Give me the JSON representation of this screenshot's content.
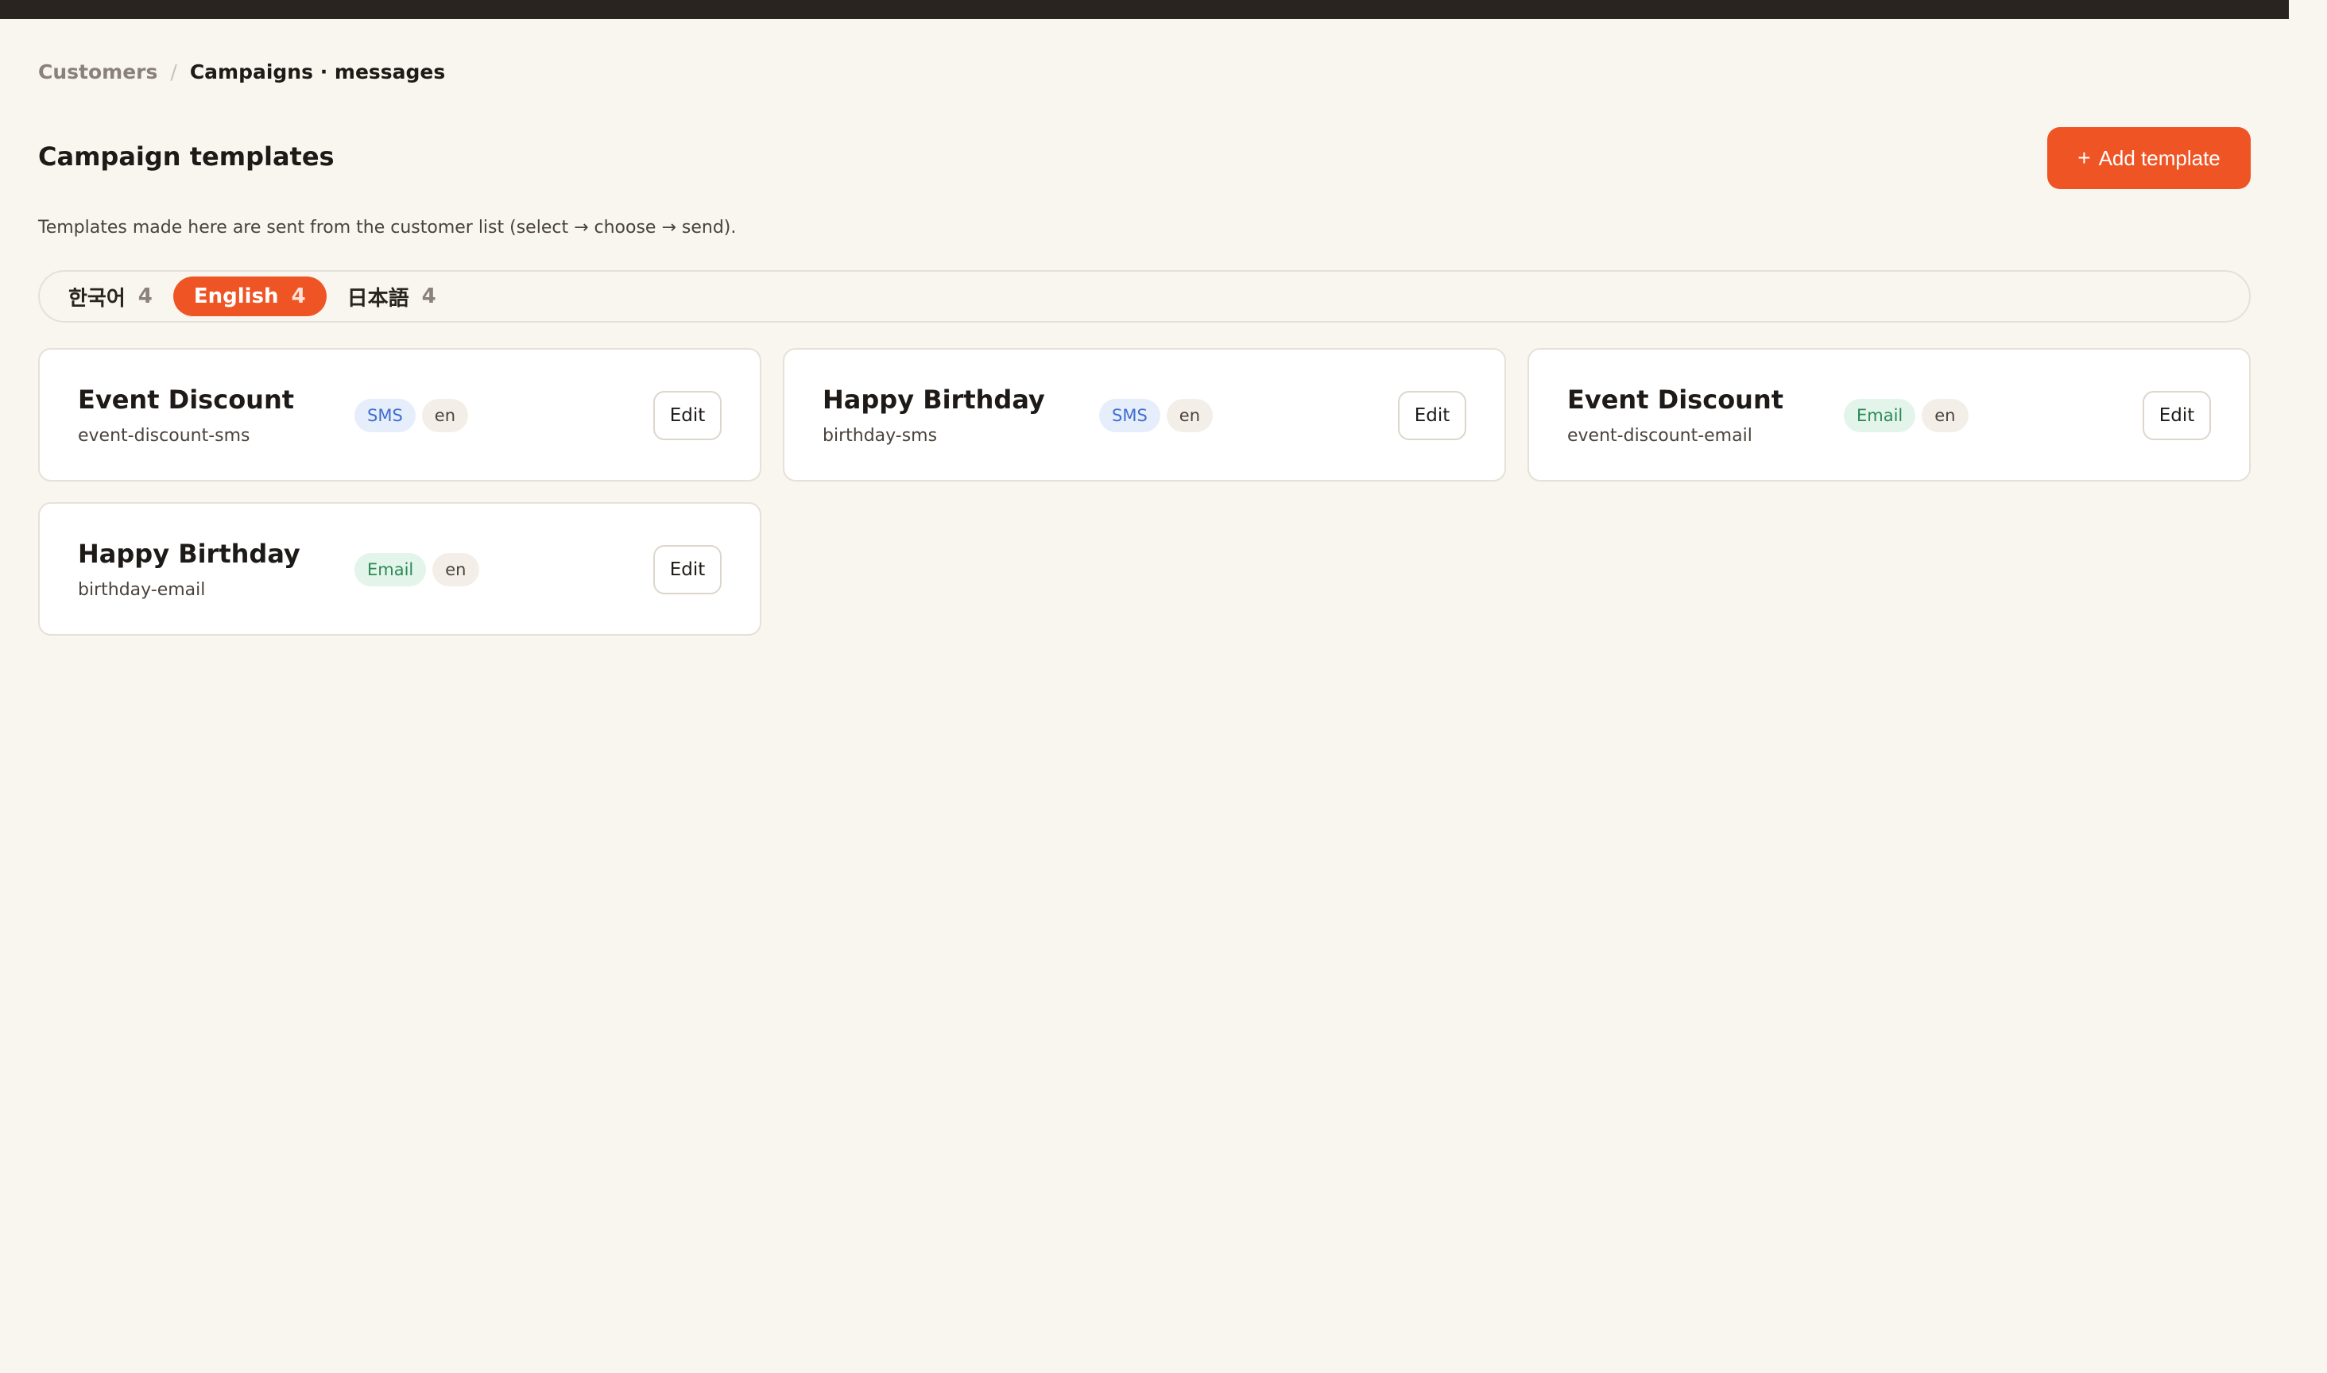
{
  "breadcrumb": {
    "parent": "Customers",
    "separator": "/",
    "current": "Campaigns · messages"
  },
  "header": {
    "title": "Campaign templates",
    "add_button": {
      "icon": "plus-icon",
      "plus": "+",
      "label": "Add template"
    }
  },
  "subtitle": "Templates made here are sent from the customer list (select → choose → send).",
  "language_tabs": [
    {
      "label": "한국어",
      "count": "4",
      "active": false
    },
    {
      "label": "English",
      "count": "4",
      "active": true
    },
    {
      "label": "日本語",
      "count": "4",
      "active": false
    }
  ],
  "templates": [
    {
      "name": "Event Discount",
      "slug": "event-discount-sms",
      "channel": "SMS",
      "lang": "en",
      "edit_label": "Edit"
    },
    {
      "name": "Happy Birthday",
      "slug": "birthday-sms",
      "channel": "SMS",
      "lang": "en",
      "edit_label": "Edit"
    },
    {
      "name": "Event Discount",
      "slug": "event-discount-email",
      "channel": "Email",
      "lang": "en",
      "edit_label": "Edit"
    },
    {
      "name": "Happy Birthday",
      "slug": "birthday-email",
      "channel": "Email",
      "lang": "en",
      "edit_label": "Edit"
    }
  ],
  "colors": {
    "accent": "#ef5424",
    "background": "#f9f6ef",
    "topbar": "#2a2420",
    "sms_badge": "#3d6fd0",
    "email_badge": "#2b8a55"
  }
}
